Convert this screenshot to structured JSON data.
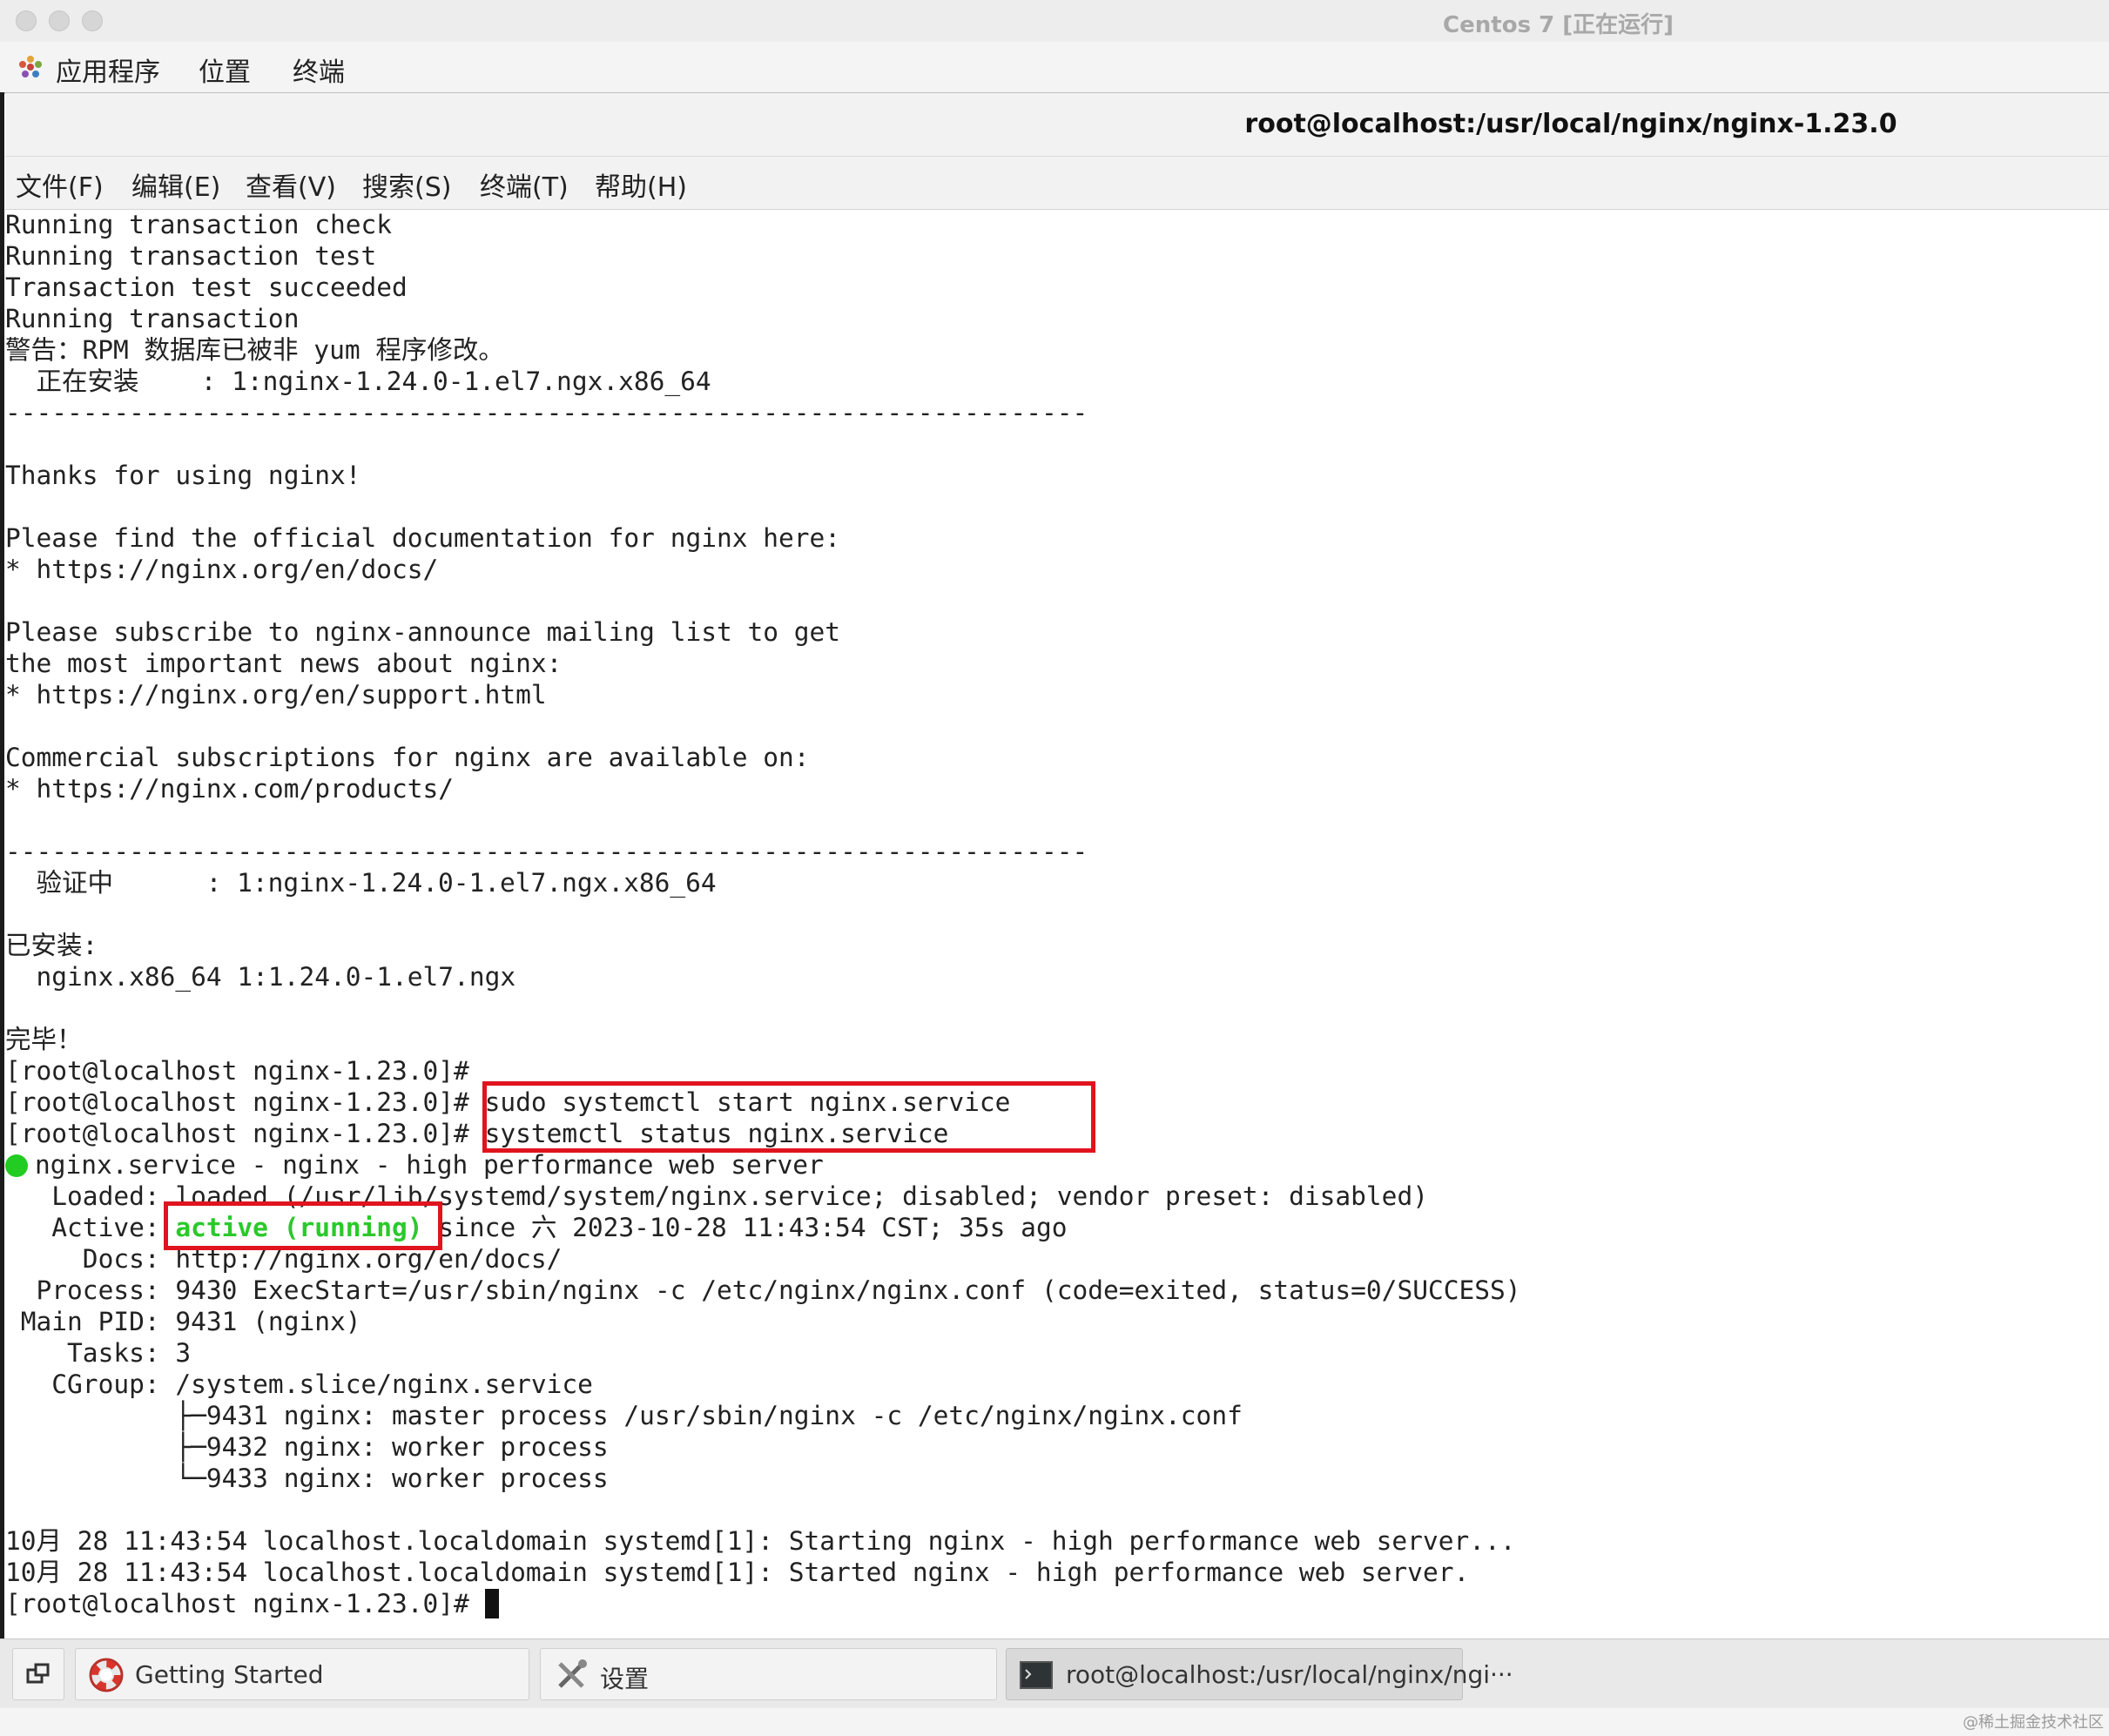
{
  "window": {
    "title": "Centos 7 [正在运行]"
  },
  "gnome_bar": {
    "applications": "应用程序",
    "places": "位置",
    "terminal": "终端"
  },
  "terminal": {
    "title": "root@localhost:/usr/local/nginx/nginx-1.23.0",
    "menu": [
      "文件(F)",
      "编辑(E)",
      "查看(V)",
      "搜索(S)",
      "终端(T)",
      "帮助(H)"
    ],
    "lines": [
      "Running transaction check",
      "Running transaction test",
      "Transaction test succeeded",
      "Running transaction",
      "警告：RPM 数据库已被非 yum 程序修改。",
      "  正在安装    : 1:nginx-1.24.0-1.el7.ngx.x86_64",
      "----------------------------------------------------------------------",
      "",
      "Thanks for using nginx!",
      "",
      "Please find the official documentation for nginx here:",
      "* https://nginx.org/en/docs/",
      "",
      "Please subscribe to nginx-announce mailing list to get",
      "the most important news about nginx:",
      "* https://nginx.org/en/support.html",
      "",
      "Commercial subscriptions for nginx are available on:",
      "* https://nginx.com/products/",
      "",
      "----------------------------------------------------------------------",
      "  验证中      : 1:nginx-1.24.0-1.el7.ngx.x86_64",
      "",
      "已安装:",
      "  nginx.x86_64 1:1.24.0-1.el7.ngx",
      "",
      "完毕！",
      "[root@localhost nginx-1.23.0]# "
    ],
    "prompt": "[root@localhost nginx-1.23.0]# ",
    "cmd_start": "sudo systemctl start nginx.service",
    "cmd_status": "systemctl status nginx.service",
    "status": {
      "header": "nginx.service - nginx - high performance web server",
      "loaded_line": "   Loaded: loaded (/usr/lib/systemd/system/nginx.service; disabled; vendor preset: disabled)",
      "active_label": "   Active: ",
      "active_state": "active (running)",
      "active_since": " since 六 2023-10-28 11:43:54 CST; 35s ago",
      "docs_line": "     Docs: http://nginx.org/en/docs/",
      "process_line": "  Process: 9430 ExecStart=/usr/sbin/nginx -c /etc/nginx/nginx.conf (code=exited, status=0/SUCCESS)",
      "mainpid_line": " Main PID: 9431 (nginx)",
      "tasks_line": "    Tasks: 3",
      "cgroup_line": "   CGroup: /system.slice/nginx.service",
      "tree": [
        "           ├─9431 nginx: master process /usr/sbin/nginx -c /etc/nginx/nginx.conf",
        "           ├─9432 nginx: worker process",
        "           └─9433 nginx: worker process"
      ]
    },
    "log_lines": [
      "10月 28 11:43:54 localhost.localdomain systemd[1]: Starting nginx - high performance web server...",
      "10月 28 11:43:54 localhost.localdomain systemd[1]: Started nginx - high performance web server."
    ]
  },
  "taskbar": {
    "items": [
      {
        "label": "Getting Started",
        "icon": "lifebuoy-icon"
      },
      {
        "label": "设置",
        "icon": "tools-icon"
      },
      {
        "label": "root@localhost:/usr/local/nginx/ngi···",
        "icon": "terminal-icon"
      }
    ]
  },
  "watermark": "@稀土掘金技术社区",
  "colors": {
    "highlight_box": "#e0141e",
    "status_green": "#2ac92a"
  }
}
